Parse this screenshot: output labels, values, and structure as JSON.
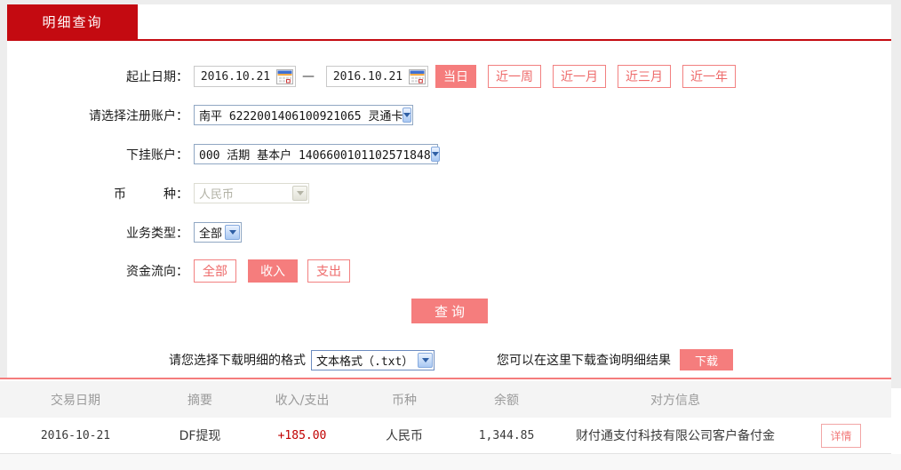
{
  "tab": {
    "label": "明细查询"
  },
  "form": {
    "date_row": {
      "label": "起止日期：",
      "from": "2016.10.21",
      "to": "2016.10.21",
      "separator": "—",
      "quick_buttons": [
        {
          "label": "当日",
          "active": true
        },
        {
          "label": "近一周",
          "active": false
        },
        {
          "label": "近一月",
          "active": false
        },
        {
          "label": "近三月",
          "active": false
        },
        {
          "label": "近一年",
          "active": false
        }
      ]
    },
    "register_account": {
      "label": "请选择注册账户：",
      "value": "南平 6222001406100921065 灵通卡"
    },
    "sub_account": {
      "label": "下挂账户：",
      "value": "000 活期 基本户 1406600101102571848"
    },
    "currency": {
      "label": "币　　　种：",
      "value": "人民币",
      "disabled": true
    },
    "business_type": {
      "label": "业务类型：",
      "value": "全部"
    },
    "fund_flow": {
      "label": "资金流向：",
      "options": [
        {
          "label": "全部",
          "active": false
        },
        {
          "label": "收入",
          "active": true
        },
        {
          "label": "支出",
          "active": false
        }
      ]
    },
    "query_button": "查询",
    "download": {
      "format_label": "请您选择下载明细的格式",
      "format_value": "文本格式（.txt）",
      "hint": "您可以在这里下载查询明细结果",
      "button": "下载"
    }
  },
  "table": {
    "headers": [
      "交易日期",
      "摘要",
      "收入/支出",
      "币种",
      "余额",
      "对方信息"
    ],
    "rows": [
      {
        "date": "2016-10-21",
        "summary": "DF提现",
        "amount": "+185.00",
        "currency": "人民币",
        "balance": "1,344.85",
        "counterparty": "财付通支付科技有限公司客户备付金",
        "action": "详情"
      }
    ]
  },
  "icons": {
    "calendar": "calendar-icon",
    "select_arrow": "chevron-down-icon"
  },
  "colors": {
    "brand_red": "#c40a11",
    "accent_salmon": "#f57d7d",
    "outline_pink": "#f28080",
    "amount_red": "#c00000",
    "header_text": "#9a9a9a",
    "header_bg": "#f4f4f4",
    "page_bg": "#ededed"
  }
}
